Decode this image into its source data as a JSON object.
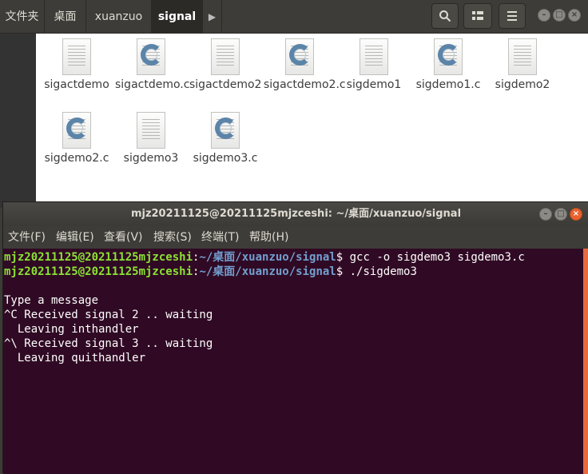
{
  "file_manager": {
    "breadcrumbs": [
      "文件夹",
      "桌面",
      "xuanzuo",
      "signal"
    ],
    "next_arrow": "▶",
    "icons": {
      "search": "search-icon",
      "view": "list-view-icon",
      "menu": "hamburger-menu-icon"
    },
    "files": [
      {
        "name": "sigactdemo",
        "type": "text"
      },
      {
        "name": "sigactdemo.c",
        "type": "c"
      },
      {
        "name": "sigactdemo2",
        "type": "text"
      },
      {
        "name": "sigactdemo2.c",
        "type": "c"
      },
      {
        "name": "sigdemo1",
        "type": "text"
      },
      {
        "name": "sigdemo1.c",
        "type": "c"
      },
      {
        "name": "sigdemo2",
        "type": "text"
      },
      {
        "name": "sigdemo2.c",
        "type": "c"
      },
      {
        "name": "sigdemo3",
        "type": "text"
      },
      {
        "name": "sigdemo3.c",
        "type": "c"
      }
    ]
  },
  "terminal": {
    "title": "mjz20211125@20211125mjzceshi: ~/桌面/xuanzuo/signal",
    "menu": [
      "文件(F)",
      "编辑(E)",
      "查看(V)",
      "搜索(S)",
      "终端(T)",
      "帮助(H)"
    ],
    "prompt_user": "mjz20211125@20211125mjzceshi",
    "prompt_path": "~/桌面/xuanzuo/signal",
    "commands": [
      "gcc -o sigdemo3 sigdemo3.c",
      "./sigdemo3"
    ],
    "output": [
      "",
      "Type a message",
      "^C Received signal 2 .. waiting",
      "  Leaving inthandler",
      "^\\ Received signal 3 .. waiting",
      "  Leaving quithandler"
    ]
  },
  "colors": {
    "terminal_bg": "#300a24",
    "prompt_user": "#8ae234",
    "prompt_path": "#729fcf",
    "accent_close": "#e9622e"
  }
}
